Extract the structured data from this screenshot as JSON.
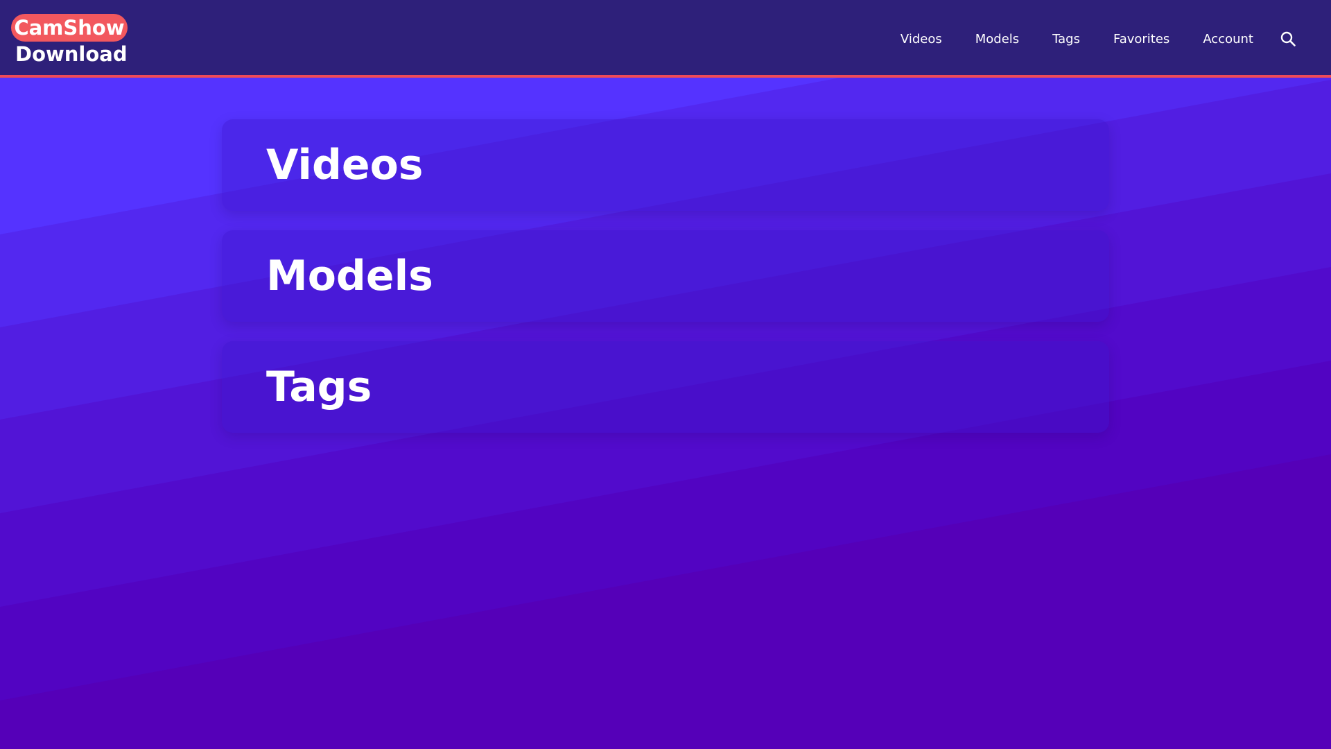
{
  "header": {
    "logo": {
      "line1": "CamShow",
      "line2": "Download"
    },
    "nav": [
      {
        "label": "Videos"
      },
      {
        "label": "Models"
      },
      {
        "label": "Tags"
      },
      {
        "label": "Favorites"
      },
      {
        "label": "Account"
      }
    ],
    "search_icon": "search-icon"
  },
  "main": {
    "cards": [
      {
        "label": "Videos"
      },
      {
        "label": "Models"
      },
      {
        "label": "Tags"
      }
    ]
  },
  "colors": {
    "header_bg": "#2e207a",
    "header_border": "#f04a58",
    "logo_badge": "#f2585e",
    "page_bg_top": "#5533ff",
    "page_bg_bottom": "#5500b8"
  }
}
